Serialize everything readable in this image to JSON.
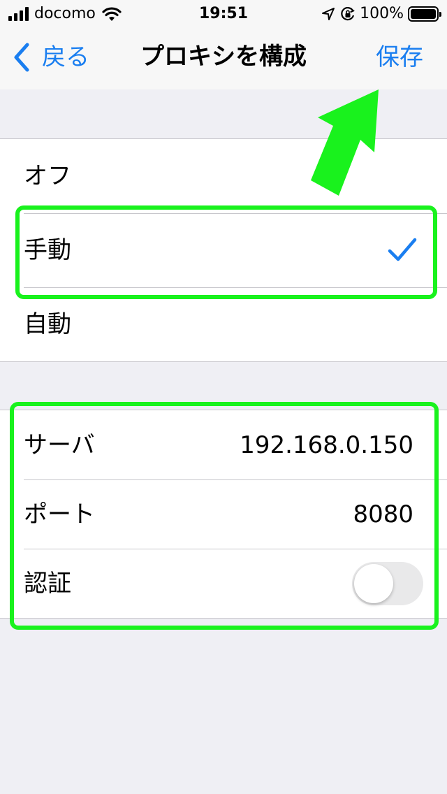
{
  "status_bar": {
    "carrier": "docomo",
    "time": "19:51",
    "battery": "100%",
    "battery_level": 1.0,
    "icons": [
      "signal-icon",
      "wifi-icon",
      "location-icon",
      "orientation-lock-icon",
      "battery-icon"
    ]
  },
  "nav": {
    "back_label": "戻る",
    "title": "プロキシを構成",
    "save_label": "保存",
    "icons": [
      "chevron-left-icon"
    ]
  },
  "proxy_modes": [
    {
      "label": "オフ",
      "selected": false
    },
    {
      "label": "手動",
      "selected": true
    },
    {
      "label": "自動",
      "selected": false
    }
  ],
  "manual_settings": {
    "server_label": "サーバ",
    "server_value": "192.168.0.150",
    "port_label": "ポート",
    "port_value": "8080",
    "auth_label": "認証",
    "auth_enabled": false
  },
  "colors": {
    "accent": "#1a7ef0",
    "annotation": "#19f21d",
    "background": "#efeff4"
  }
}
